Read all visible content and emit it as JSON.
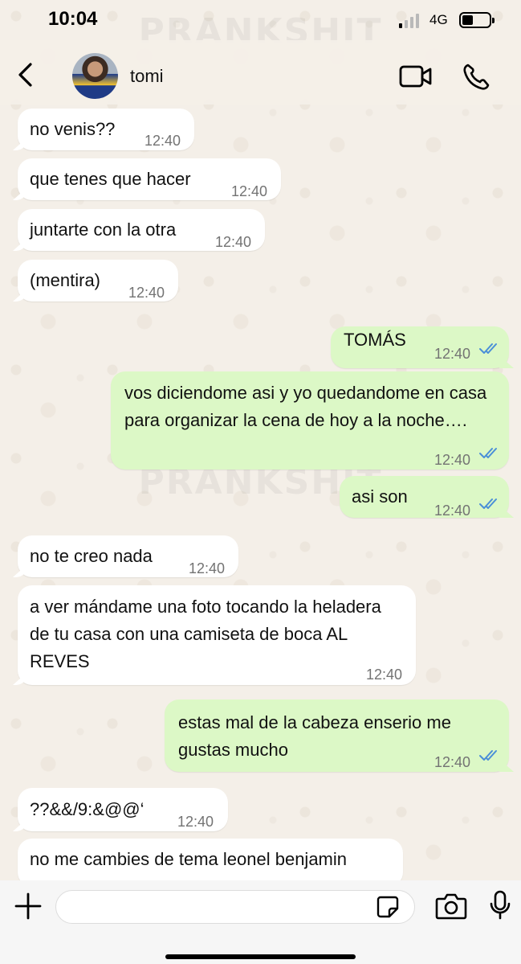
{
  "status_bar": {
    "time": "10:04",
    "network": "4G"
  },
  "header": {
    "contact_name": "tomi"
  },
  "watermark": "PRANKSHIT",
  "messages": [
    {
      "dir": "in",
      "text": "no venis??",
      "time": "12:40"
    },
    {
      "dir": "in",
      "text": "que tenes que hacer",
      "time": "12:40"
    },
    {
      "dir": "in",
      "text": "juntarte con la otra",
      "time": "12:40"
    },
    {
      "dir": "in",
      "text": "(mentira)",
      "time": "12:40"
    },
    {
      "dir": "out",
      "text": "TOMÁS",
      "time": "12:40"
    },
    {
      "dir": "out",
      "text": "vos diciendome asi y yo quedandome en casa para organizar la cena de hoy a la noche….",
      "time": "12:40"
    },
    {
      "dir": "out",
      "text": "asi son",
      "time": "12:40"
    },
    {
      "dir": "in",
      "text": "no te creo nada",
      "time": "12:40"
    },
    {
      "dir": "in",
      "text": "a ver mándame una foto tocando la heladera de tu casa con una camiseta de boca AL REVES",
      "time": "12:40"
    },
    {
      "dir": "out",
      "text": "estas mal de la cabeza enserio me gustas mucho",
      "time": "12:40"
    },
    {
      "dir": "in",
      "text": "??&&/9:&@@‘",
      "time": "12:40"
    },
    {
      "dir": "in",
      "text": "no me cambies de tema leonel benjamin",
      "time": ""
    }
  ],
  "colors": {
    "outgoing_bubble": "#dcf8c6",
    "incoming_bubble": "#ffffff",
    "read_ticks": "#4a8fd8"
  },
  "icons": [
    "back-arrow",
    "video-camera",
    "phone",
    "plus",
    "sticker",
    "camera",
    "microphone",
    "double-check"
  ]
}
